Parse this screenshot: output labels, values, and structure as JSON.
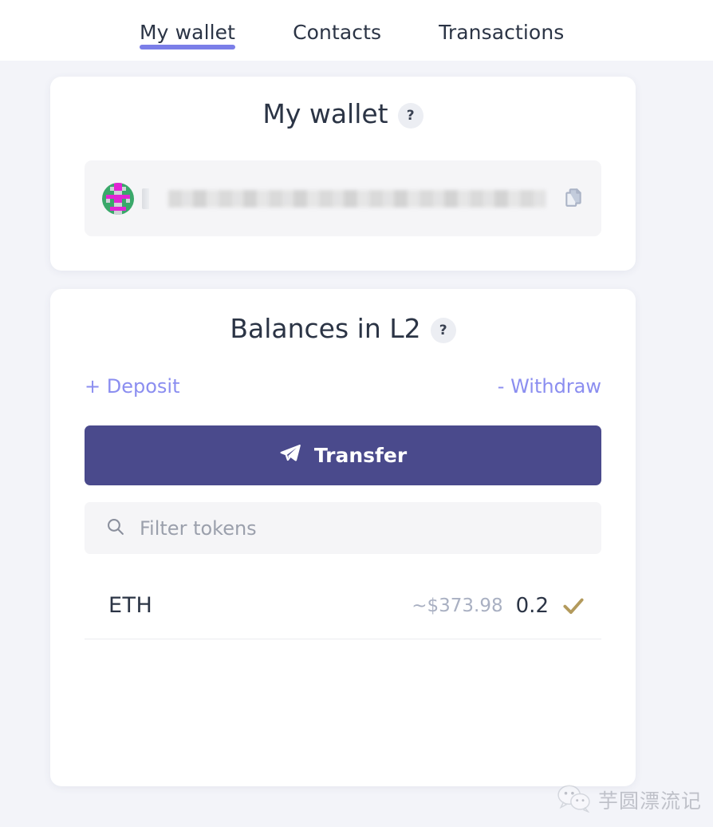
{
  "theme": {
    "page_background": "#f3f4f9",
    "card_background": "#ffffff",
    "accent_purple": "#7b7ee8",
    "link_purple": "#8b8ef0",
    "button_indigo": "#4a4a8c",
    "text_dark": "#2b3445",
    "text_muted": "#a9b0c2",
    "check_gold": "#b39a5c"
  },
  "nav": {
    "tabs": [
      {
        "label": "My wallet",
        "active": true,
        "icon": ""
      },
      {
        "label": "Contacts",
        "active": false,
        "icon": ""
      },
      {
        "label": "Transactions",
        "active": false,
        "icon": ""
      }
    ]
  },
  "wallet_card": {
    "title": "My wallet",
    "help_badge": "?",
    "help_icon": "question-mark-icon",
    "avatar_icon": "identicon-blockie-avatar",
    "address_value": "",
    "address_state": "blurred",
    "copy_icon": "copy-icon"
  },
  "balances_card": {
    "title": "Balances in L2",
    "help_badge": "?",
    "help_icon": "question-mark-icon",
    "deposit_label": "+ Deposit",
    "withdraw_label": "- Withdraw",
    "transfer_label": "Transfer",
    "transfer_icon": "paper-plane-send-icon",
    "filter": {
      "placeholder": "Filter tokens",
      "value": "",
      "icon": "search-icon"
    },
    "tokens": [
      {
        "symbol": "ETH",
        "fiat": "~$373.98",
        "amount": "0.2",
        "status_icon": "checkmark-icon"
      }
    ]
  },
  "watermark": {
    "text": "芋圆漂流记",
    "icon": "wechat-logo-icon"
  }
}
